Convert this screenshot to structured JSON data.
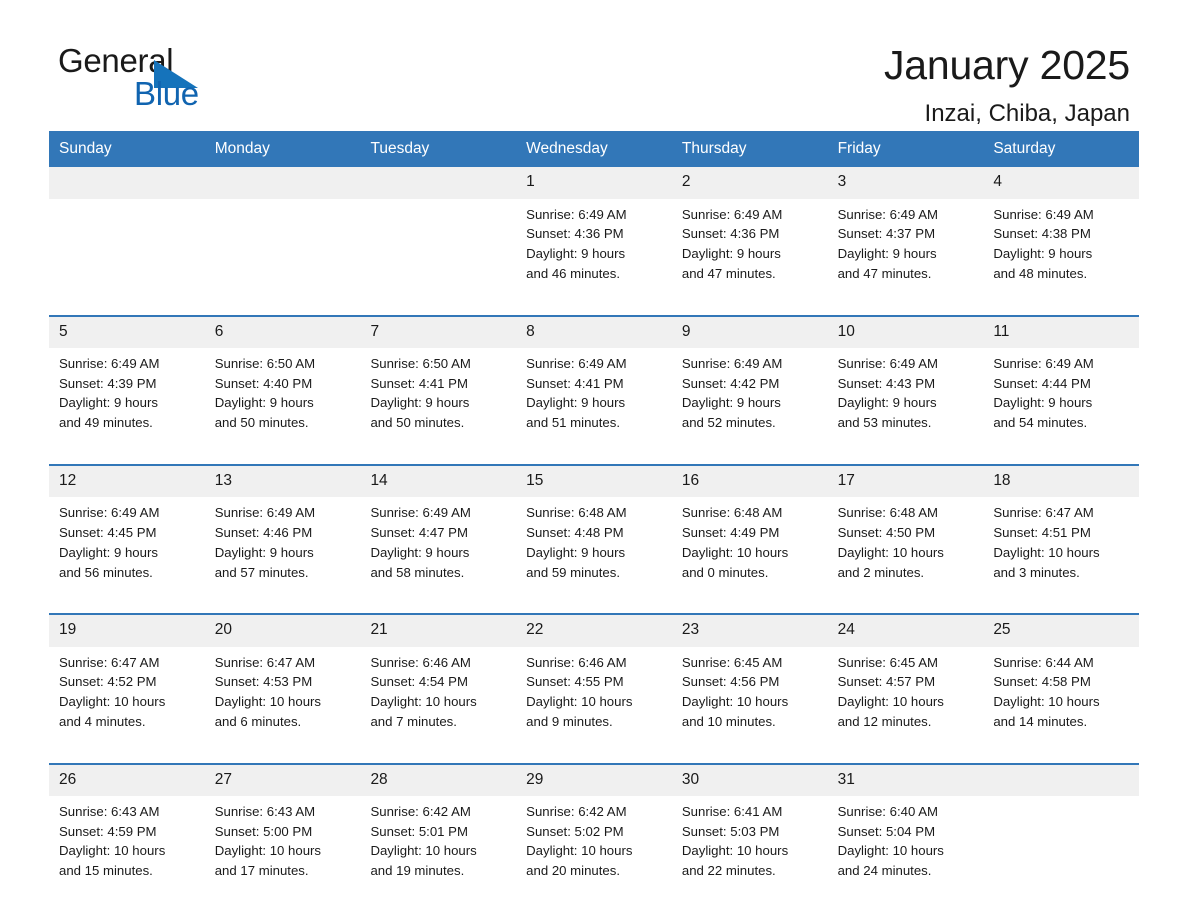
{
  "brand": {
    "name_part1": "General",
    "name_part2": "Blue",
    "triangle_color": "#1573bb",
    "blue_color": "#1064b0"
  },
  "header": {
    "title": "January 2025",
    "subtitle": "Inzai, Chiba, Japan"
  },
  "theme": {
    "header_band": "#3277b8",
    "daynum_band": "#f0f0f0",
    "row_rule": "#3277b8",
    "text": "#1a1a1a"
  },
  "weekdays": [
    "Sunday",
    "Monday",
    "Tuesday",
    "Wednesday",
    "Thursday",
    "Friday",
    "Saturday"
  ],
  "weeks": [
    [
      {
        "day": "",
        "lines": []
      },
      {
        "day": "",
        "lines": []
      },
      {
        "day": "",
        "lines": []
      },
      {
        "day": "1",
        "lines": [
          "Sunrise: 6:49 AM",
          "Sunset: 4:36 PM",
          "Daylight: 9 hours",
          "and 46 minutes."
        ]
      },
      {
        "day": "2",
        "lines": [
          "Sunrise: 6:49 AM",
          "Sunset: 4:36 PM",
          "Daylight: 9 hours",
          "and 47 minutes."
        ]
      },
      {
        "day": "3",
        "lines": [
          "Sunrise: 6:49 AM",
          "Sunset: 4:37 PM",
          "Daylight: 9 hours",
          "and 47 minutes."
        ]
      },
      {
        "day": "4",
        "lines": [
          "Sunrise: 6:49 AM",
          "Sunset: 4:38 PM",
          "Daylight: 9 hours",
          "and 48 minutes."
        ]
      }
    ],
    [
      {
        "day": "5",
        "lines": [
          "Sunrise: 6:49 AM",
          "Sunset: 4:39 PM",
          "Daylight: 9 hours",
          "and 49 minutes."
        ]
      },
      {
        "day": "6",
        "lines": [
          "Sunrise: 6:50 AM",
          "Sunset: 4:40 PM",
          "Daylight: 9 hours",
          "and 50 minutes."
        ]
      },
      {
        "day": "7",
        "lines": [
          "Sunrise: 6:50 AM",
          "Sunset: 4:41 PM",
          "Daylight: 9 hours",
          "and 50 minutes."
        ]
      },
      {
        "day": "8",
        "lines": [
          "Sunrise: 6:49 AM",
          "Sunset: 4:41 PM",
          "Daylight: 9 hours",
          "and 51 minutes."
        ]
      },
      {
        "day": "9",
        "lines": [
          "Sunrise: 6:49 AM",
          "Sunset: 4:42 PM",
          "Daylight: 9 hours",
          "and 52 minutes."
        ]
      },
      {
        "day": "10",
        "lines": [
          "Sunrise: 6:49 AM",
          "Sunset: 4:43 PM",
          "Daylight: 9 hours",
          "and 53 minutes."
        ]
      },
      {
        "day": "11",
        "lines": [
          "Sunrise: 6:49 AM",
          "Sunset: 4:44 PM",
          "Daylight: 9 hours",
          "and 54 minutes."
        ]
      }
    ],
    [
      {
        "day": "12",
        "lines": [
          "Sunrise: 6:49 AM",
          "Sunset: 4:45 PM",
          "Daylight: 9 hours",
          "and 56 minutes."
        ]
      },
      {
        "day": "13",
        "lines": [
          "Sunrise: 6:49 AM",
          "Sunset: 4:46 PM",
          "Daylight: 9 hours",
          "and 57 minutes."
        ]
      },
      {
        "day": "14",
        "lines": [
          "Sunrise: 6:49 AM",
          "Sunset: 4:47 PM",
          "Daylight: 9 hours",
          "and 58 minutes."
        ]
      },
      {
        "day": "15",
        "lines": [
          "Sunrise: 6:48 AM",
          "Sunset: 4:48 PM",
          "Daylight: 9 hours",
          "and 59 minutes."
        ]
      },
      {
        "day": "16",
        "lines": [
          "Sunrise: 6:48 AM",
          "Sunset: 4:49 PM",
          "Daylight: 10 hours",
          "and 0 minutes."
        ]
      },
      {
        "day": "17",
        "lines": [
          "Sunrise: 6:48 AM",
          "Sunset: 4:50 PM",
          "Daylight: 10 hours",
          "and 2 minutes."
        ]
      },
      {
        "day": "18",
        "lines": [
          "Sunrise: 6:47 AM",
          "Sunset: 4:51 PM",
          "Daylight: 10 hours",
          "and 3 minutes."
        ]
      }
    ],
    [
      {
        "day": "19",
        "lines": [
          "Sunrise: 6:47 AM",
          "Sunset: 4:52 PM",
          "Daylight: 10 hours",
          "and 4 minutes."
        ]
      },
      {
        "day": "20",
        "lines": [
          "Sunrise: 6:47 AM",
          "Sunset: 4:53 PM",
          "Daylight: 10 hours",
          "and 6 minutes."
        ]
      },
      {
        "day": "21",
        "lines": [
          "Sunrise: 6:46 AM",
          "Sunset: 4:54 PM",
          "Daylight: 10 hours",
          "and 7 minutes."
        ]
      },
      {
        "day": "22",
        "lines": [
          "Sunrise: 6:46 AM",
          "Sunset: 4:55 PM",
          "Daylight: 10 hours",
          "and 9 minutes."
        ]
      },
      {
        "day": "23",
        "lines": [
          "Sunrise: 6:45 AM",
          "Sunset: 4:56 PM",
          "Daylight: 10 hours",
          "and 10 minutes."
        ]
      },
      {
        "day": "24",
        "lines": [
          "Sunrise: 6:45 AM",
          "Sunset: 4:57 PM",
          "Daylight: 10 hours",
          "and 12 minutes."
        ]
      },
      {
        "day": "25",
        "lines": [
          "Sunrise: 6:44 AM",
          "Sunset: 4:58 PM",
          "Daylight: 10 hours",
          "and 14 minutes."
        ]
      }
    ],
    [
      {
        "day": "26",
        "lines": [
          "Sunrise: 6:43 AM",
          "Sunset: 4:59 PM",
          "Daylight: 10 hours",
          "and 15 minutes."
        ]
      },
      {
        "day": "27",
        "lines": [
          "Sunrise: 6:43 AM",
          "Sunset: 5:00 PM",
          "Daylight: 10 hours",
          "and 17 minutes."
        ]
      },
      {
        "day": "28",
        "lines": [
          "Sunrise: 6:42 AM",
          "Sunset: 5:01 PM",
          "Daylight: 10 hours",
          "and 19 minutes."
        ]
      },
      {
        "day": "29",
        "lines": [
          "Sunrise: 6:42 AM",
          "Sunset: 5:02 PM",
          "Daylight: 10 hours",
          "and 20 minutes."
        ]
      },
      {
        "day": "30",
        "lines": [
          "Sunrise: 6:41 AM",
          "Sunset: 5:03 PM",
          "Daylight: 10 hours",
          "and 22 minutes."
        ]
      },
      {
        "day": "31",
        "lines": [
          "Sunrise: 6:40 AM",
          "Sunset: 5:04 PM",
          "Daylight: 10 hours",
          "and 24 minutes."
        ]
      },
      {
        "day": "",
        "lines": []
      }
    ]
  ]
}
